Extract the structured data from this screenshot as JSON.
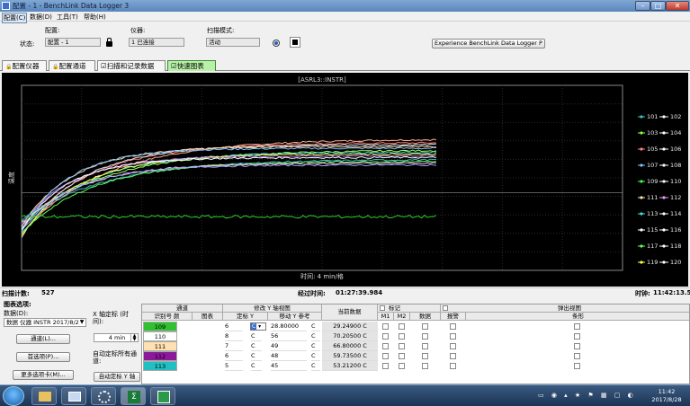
{
  "window": {
    "title": "配置 - 1 - BenchLink Data Logger 3"
  },
  "menu": [
    "配置(C)",
    "数据(D)",
    "工具(T)",
    "帮助(H)"
  ],
  "top": {
    "config_label": "配置:",
    "instrument_label": "仪器:",
    "scan_mode_label": "扫描模式:",
    "status_label": "状态:",
    "config_value": "配置 - 1",
    "instrument_value": "1 已连接",
    "scan_mode_value": "活动",
    "experience_button": "Experience BenchLink Data Logger P"
  },
  "tabs": [
    {
      "label": "配置仪器",
      "active": false
    },
    {
      "label": "配置通道",
      "active": false
    },
    {
      "label": "扫描和记录数据",
      "active": false
    },
    {
      "label": "快速图表",
      "active": true
    }
  ],
  "chart_data": {
    "type": "line",
    "title": "[ASRL3::INSTR]",
    "xlabel": "时间: 4 min/格",
    "ylabel": "温度",
    "grid": true,
    "legend_placement": "right",
    "legend": [
      {
        "a": "101",
        "b": "102",
        "ca": "#40c0c0",
        "cb": "#ffffff"
      },
      {
        "a": "103",
        "b": "104",
        "ca": "#80ff40",
        "cb": "#ffffff"
      },
      {
        "a": "105",
        "b": "106",
        "ca": "#ff8080",
        "cb": "#ffffff"
      },
      {
        "a": "107",
        "b": "108",
        "ca": "#80c0ff",
        "cb": "#ffffff"
      },
      {
        "a": "109",
        "b": "110",
        "ca": "#40ff40",
        "cb": "#ffffff"
      },
      {
        "a": "111",
        "b": "112",
        "ca": "#ffe0b0",
        "cb": "#e0a0ff"
      },
      {
        "a": "113",
        "b": "114",
        "ca": "#40e0e0",
        "cb": "#ffffff"
      },
      {
        "a": "115",
        "b": "116",
        "ca": "#ffffff",
        "cb": "#ffffff"
      },
      {
        "a": "117",
        "b": "118",
        "ca": "#60ff60",
        "cb": "#ffffff"
      },
      {
        "a": "119",
        "b": "120",
        "ca": "#ffff40",
        "cb": "#ffffff"
      }
    ],
    "series": [
      {
        "color": "#ffb090",
        "start": 20,
        "end": 71
      },
      {
        "color": "#ff8080",
        "start": 22,
        "end": 69
      },
      {
        "color": "#e0e0e0",
        "start": 18,
        "end": 68
      },
      {
        "color": "#ffe0b0",
        "start": 24,
        "end": 67
      },
      {
        "color": "#80c0ff",
        "start": 21,
        "end": 66
      },
      {
        "color": "#a0ff60",
        "start": 26,
        "end": 65
      },
      {
        "color": "#40e0e0",
        "start": 23,
        "end": 64
      },
      {
        "color": "#ffff40",
        "start": 19,
        "end": 63
      },
      {
        "color": "#c080ff",
        "start": 25,
        "end": 62
      },
      {
        "color": "#ffffff",
        "start": 22,
        "end": 61
      },
      {
        "color": "#40c0c0",
        "start": 27,
        "end": 60
      },
      {
        "color": "#60ff60",
        "start": 20,
        "end": 59
      },
      {
        "color": "#ffc0e0",
        "start": 24,
        "end": 58
      },
      {
        "color": "#a0a0ff",
        "start": 21,
        "end": 57
      },
      {
        "color": "#30d030",
        "start": 29,
        "end": 29
      }
    ],
    "time_extent_fraction": 0.69
  },
  "status": {
    "scan_count_label": "扫描计数:",
    "scan_count": "527",
    "elapsed_label": "经过时间:",
    "elapsed": "01:27:39.984",
    "clock_label": "时钟:",
    "clock": "11:42:13.58"
  },
  "bottom": {
    "chart_options_label": "图表选项:",
    "data_label": "数据(D):",
    "data_select": "数据 仪器 INSTR 2017/8/2",
    "channel_button": "通道(L)...",
    "preferences_button": "首选项(P)...",
    "more_tabs_button": "更多选项卡(M)...",
    "x_axis_label": "X 轴定标 (时间):",
    "x_axis_value": "4 min",
    "auto_all_label": "自动定标所有通道:",
    "auto_y_button": "自动定标 Y 轴"
  },
  "grid": {
    "group_headers": [
      "通道",
      "修改 Y 轴视图",
      "当前数据",
      "标记",
      "弹出视图"
    ],
    "headers": [
      "识别号",
      "颜",
      "图表",
      "定标 Y",
      "移动 Y 参考",
      "M1",
      "M2",
      "数据",
      "报警",
      "条形"
    ],
    "rows": [
      {
        "id": "109",
        "color": "#30c030",
        "scale": "6",
        "unit1": "C",
        "offset": "28.80000",
        "unit2": "C",
        "value": "29.24900 C"
      },
      {
        "id": "110",
        "color": "#ffffff",
        "scale": "8",
        "unit1": "C",
        "offset": "56",
        "unit2": "C",
        "value": "70.20500 C"
      },
      {
        "id": "111",
        "color": "#ffe0b0",
        "scale": "7",
        "unit1": "C",
        "offset": "49",
        "unit2": "C",
        "value": "66.80000 C"
      },
      {
        "id": "112",
        "color": "#8a1a9a",
        "scale": "6",
        "unit1": "C",
        "offset": "48",
        "unit2": "C",
        "value": "59.73500 C"
      },
      {
        "id": "113",
        "color": "#20c0c0",
        "scale": "5",
        "unit1": "C",
        "offset": "45",
        "unit2": "C",
        "value": "53.21200 C"
      }
    ]
  },
  "taskbar": {
    "time": "11:42",
    "date": "2017/8/28"
  }
}
